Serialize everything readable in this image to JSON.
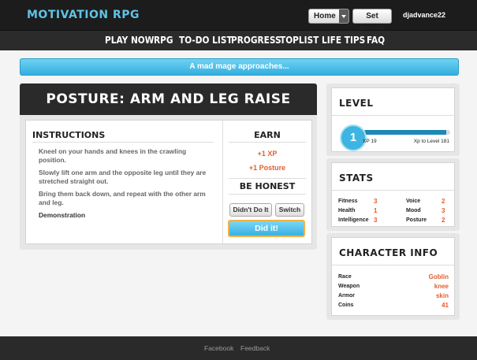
{
  "header": {
    "brand": "MOTIVATION RPG",
    "home_select": "Home",
    "set_profile": "Set Profile",
    "username": "djadvance22"
  },
  "nav": [
    "PLAY NOW",
    "RPG",
    "TO-DO LIST",
    "PROGRESS",
    "TOPLIST",
    "LIFE TIPS",
    "FAQ"
  ],
  "banner": "A mad mage approaches...",
  "task": {
    "title": "POSTURE: ARM AND LEG RAISE",
    "instructions_title": "INSTRUCTIONS",
    "instructions": [
      "Kneel on your hands and knees in the crawling position.",
      "Slowly lift one arm and the opposite leg until they are stretched straight out.",
      "Bring them back down, and repeat with the other arm and leg."
    ],
    "demonstration": "Demonstration",
    "earn_title": "EARN",
    "earn": [
      "+1 XP",
      "+1 Posture"
    ],
    "honest_title": "BE HONEST",
    "didnt_do_it": "Didn't Do It",
    "switch": "Switch",
    "did_it": "Did it!"
  },
  "level": {
    "title": "LEVEL",
    "value": "1",
    "xp": "XP 19",
    "xp_to_level": "Xp to Level 181",
    "progress": 0.95
  },
  "stats": {
    "title": "STATS",
    "left": [
      {
        "label": "Fitness",
        "value": "3"
      },
      {
        "label": "Health",
        "value": "1"
      },
      {
        "label": "Intelligence",
        "value": "3"
      }
    ],
    "right": [
      {
        "label": "Voice",
        "value": "2"
      },
      {
        "label": "Mood",
        "value": "3"
      },
      {
        "label": "Posture",
        "value": "2"
      }
    ]
  },
  "character": {
    "title": "CHARACTER INFO",
    "rows": [
      {
        "label": "Race",
        "value": "Goblin"
      },
      {
        "label": "Weapon",
        "value": "knee"
      },
      {
        "label": "Armor",
        "value": "skin"
      },
      {
        "label": "Coins",
        "value": "41"
      }
    ]
  },
  "footer": {
    "facebook": "Facebook",
    "feedback": "Feedback"
  },
  "colors": {
    "accent": "#3db4e2",
    "orange": "#e45d2a",
    "dark": "#2a2a2a"
  }
}
